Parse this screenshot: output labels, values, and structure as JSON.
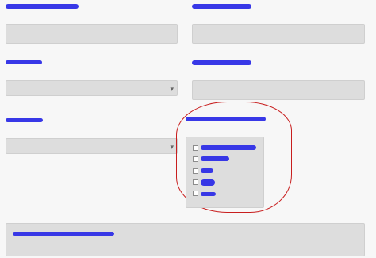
{
  "form": {
    "fields": [
      {
        "id": "field-1",
        "type": "text",
        "label": "",
        "value": "",
        "placeholder": ""
      },
      {
        "id": "field-2",
        "type": "text",
        "label": "",
        "value": "",
        "placeholder": ""
      },
      {
        "id": "field-3",
        "type": "select",
        "label": "",
        "selected": "",
        "caret": "▾"
      },
      {
        "id": "field-4",
        "type": "text",
        "label": "",
        "value": "",
        "placeholder": ""
      },
      {
        "id": "field-5",
        "type": "select",
        "label": "",
        "selected": "",
        "caret": "▾"
      },
      {
        "id": "field-6",
        "type": "checkbox-list",
        "label": "",
        "options": [
          "",
          "",
          "",
          "",
          ""
        ]
      },
      {
        "id": "field-7",
        "type": "textarea",
        "label": "",
        "value": ""
      }
    ]
  },
  "theme": {
    "redaction_color": "#2d2de6",
    "annotation_color": "#c81e1e",
    "field_background": "#dddddd",
    "page_background": "#f7f7f7"
  }
}
